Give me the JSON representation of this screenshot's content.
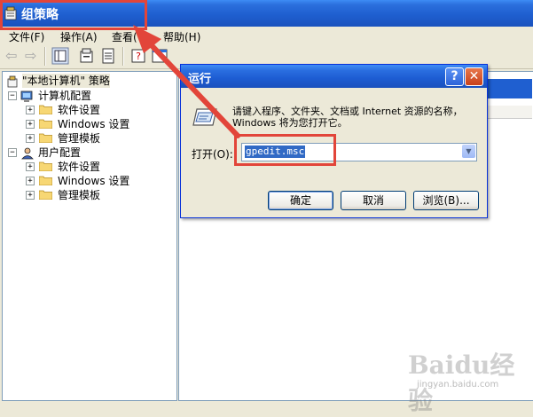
{
  "gp_window": {
    "title": "组策略",
    "menu": [
      "文件(F)",
      "操作(A)",
      "查看(V)",
      "帮助(H)"
    ],
    "tree": {
      "root": "\"本地计算机\" 策略",
      "computer": "计算机配置",
      "user": "用户配置",
      "children": [
        "软件设置",
        "Windows 设置",
        "管理模板"
      ]
    }
  },
  "run_dialog": {
    "title": "运行",
    "help_glyph": "?",
    "close_glyph": "✕",
    "description": "请键入程序、文件夹、文档或 Internet 资源的名称，Windows 将为您打开它。",
    "open_label": "打开(O):",
    "open_value": "gpedit.msc",
    "buttons": {
      "ok": "确定",
      "cancel": "取消",
      "browse": "浏览(B)..."
    }
  },
  "watermark": {
    "brand": "Baidu经验",
    "url": "jingyan.baidu.com"
  },
  "colors": {
    "annotation_red": "#e2453a",
    "xp_blue": "#1f5fd0"
  }
}
